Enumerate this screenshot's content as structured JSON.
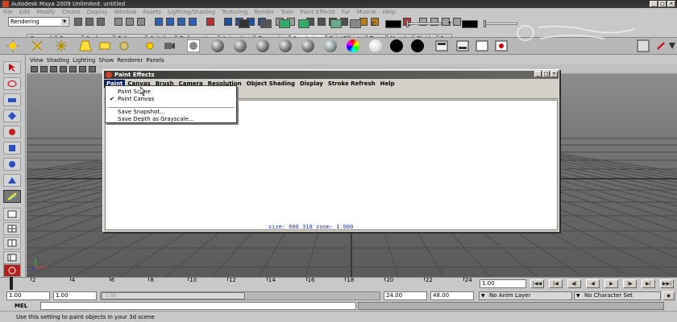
{
  "window": {
    "title": "Autodesk Maya 2009 Unlimited: untitled",
    "controls": [
      "_",
      "□",
      "×"
    ]
  },
  "main_menu": [
    "File",
    "Edit",
    "Modify",
    "Create",
    "Display",
    "Window",
    "Assets",
    "Lighting/Shading",
    "Texturing",
    "Render",
    "Toon",
    "Paint Effects",
    "Fur",
    "Muscle",
    "Help"
  ],
  "status_line": {
    "menu_set": "Rendering"
  },
  "shelf": {
    "tabs": [
      "General",
      "Curves",
      "Surfaces",
      "Polygons",
      "Subdivs",
      "Deformation",
      "Animation",
      "Dynamics",
      "Rendering",
      "PaintEffects",
      "Toon",
      "Muscle",
      "Fluids",
      "Fur"
    ],
    "active_tab": "Rendering"
  },
  "panel_menu": [
    "View",
    "Shading",
    "Lighting",
    "Show",
    "Renderer",
    "Panels"
  ],
  "paint_effects": {
    "title": "Paint Effects",
    "menus": [
      "Paint",
      "Canvas",
      "Brush",
      "Camera",
      "Resolution",
      "Object Shading",
      "Display",
      "Stroke Refresh",
      "Help"
    ],
    "open_menu": "Paint",
    "dropdown": [
      {
        "label": "Paint Scene",
        "checked": false
      },
      {
        "label": "Paint Canvas",
        "checked": true
      },
      {
        "label": "Save Snapshot...",
        "checked": false
      },
      {
        "label": "Save Depth as Grayscale...",
        "checked": false
      }
    ],
    "toolbar_labels": {
      "color": "C",
      "transparency": "T"
    },
    "status": "size:  606   318 zoom:  1.000"
  },
  "time_slider": {
    "ticks": [
      "2",
      "4",
      "6",
      "8",
      "10",
      "12",
      "14",
      "16",
      "18",
      "20",
      "22",
      "24"
    ],
    "current_frame": "1.00"
  },
  "range_slider": {
    "start": "1.00",
    "playback_start": "1.00",
    "range_label": "1.00",
    "playback_end": "24.00",
    "end": "48.00",
    "anim_layer": "No Anim Layer",
    "character_set": "No Character Set"
  },
  "command_line": {
    "label": "MEL"
  },
  "help_line": "Use this setting to paint objects in your 3d scene",
  "colors": {
    "ui_gray": "#c8c8c8",
    "menu_highlight": "#0a246a",
    "status_text": "#1a2fc0"
  }
}
